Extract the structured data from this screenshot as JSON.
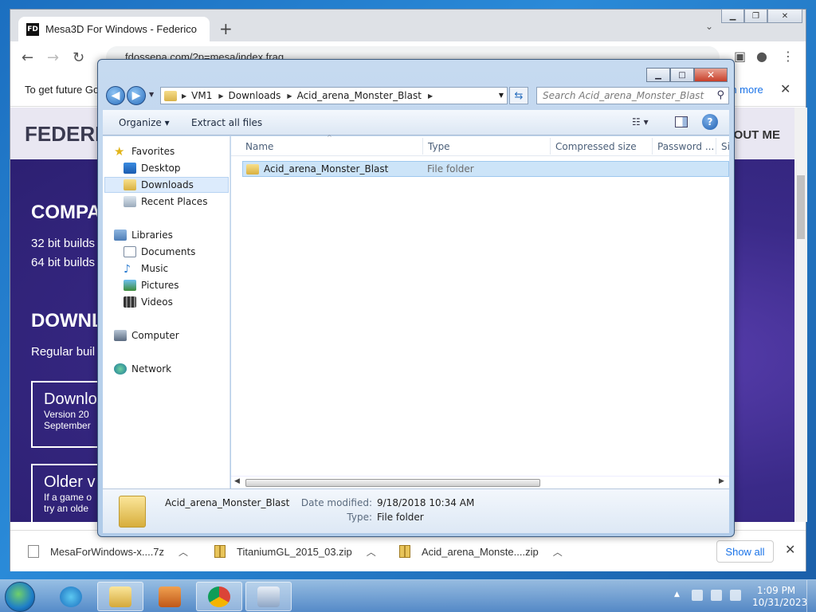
{
  "chrome": {
    "tab_title": "Mesa3D For Windows - Federico",
    "tab_favicon_text": "FD",
    "new_tab": "+",
    "url": "fdossena.com/?p=mesa/index.frag",
    "infobar_text": "To get future Go",
    "infobar_link": "rn more",
    "close_glyph": "✕"
  },
  "webpage": {
    "logo": "FEDERIC",
    "about": "OUT ME",
    "heading1": "COMPA",
    "line1": "32 bit builds",
    "line2": "64 bit builds",
    "heading2": "DOWNL",
    "line3": "Regular buil",
    "box1_title": "Downlo",
    "box1_line1": "Version 20",
    "box1_line2": "September",
    "box2_title": "Older v",
    "box2_line1": "If a game o",
    "box2_line2": "try an olde"
  },
  "downloads": {
    "items": [
      {
        "name": "MesaForWindows-x....7z"
      },
      {
        "name": "TitaniumGL_2015_03.zip"
      },
      {
        "name": "Acid_arena_Monste....zip"
      }
    ],
    "show_all": "Show all"
  },
  "explorer": {
    "breadcrumb": [
      "VM1",
      "Downloads",
      "Acid_arena_Monster_Blast"
    ],
    "search_placeholder": "Search Acid_arena_Monster_Blast",
    "toolbar": {
      "organize": "Organize ▾",
      "extract": "Extract all files"
    },
    "nav": {
      "favorites": "Favorites",
      "desktop": "Desktop",
      "downloads": "Downloads",
      "recent": "Recent Places",
      "libraries": "Libraries",
      "documents": "Documents",
      "music": "Music",
      "pictures": "Pictures",
      "videos": "Videos",
      "computer": "Computer",
      "network": "Network"
    },
    "columns": {
      "name": "Name",
      "type": "Type",
      "compressed": "Compressed size",
      "password": "Password ...",
      "size": "Si"
    },
    "rows": [
      {
        "name": "Acid_arena_Monster_Blast",
        "type": "File folder"
      }
    ],
    "details": {
      "name": "Acid_arena_Monster_Blast",
      "modified_label": "Date modified:",
      "modified_value": "9/18/2018 10:34 AM",
      "type_label": "Type:",
      "type_value": "File folder"
    }
  },
  "taskbar": {
    "time": "1:09 PM",
    "date": "10/31/2023"
  }
}
